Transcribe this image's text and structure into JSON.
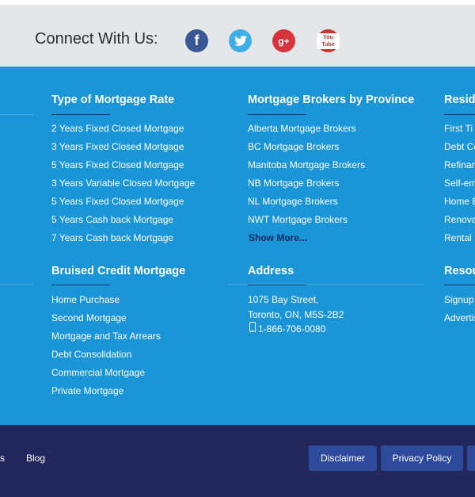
{
  "connect": {
    "title": "Connect With Us:",
    "icons": {
      "facebook": "f",
      "twitter": "🐦",
      "googleplus": "g+",
      "youtube": "You Tube"
    }
  },
  "columns": {
    "rate": {
      "heading": "Type of Mortgage Rate",
      "links": [
        "2 Years Fixed Closed Mortgage",
        "3 Years Fixed Closed Mortgage",
        "5 Years Fixed Closed Mortgage",
        "3 Years Variable Closed Mortgage",
        "5 Years Fixed Closed Mortgage",
        "5 Years Cash back Mortgage",
        "7 Years Cash back Mortgage"
      ]
    },
    "brokers": {
      "heading": "Mortgage Brokers by Province",
      "links": [
        "Alberta Mortgage Brokers",
        "BC Mortgage Brokers",
        "Manitoba Mortgage Brokers",
        "NB Mortgage Brokers",
        "NL Mortgage Brokers",
        "NWT Mortgage Brokers"
      ],
      "show_more": "Show More..."
    },
    "resid": {
      "heading": "Resid",
      "links": [
        "First Ti",
        "Debt Co",
        "Refinar",
        "Self-em",
        "Home E",
        "Renova",
        "Rental"
      ]
    },
    "bruised": {
      "heading": "Bruised Credit Mortgage",
      "links": [
        "Home Purchase",
        "Second Mortgage",
        "Mortgage and Tax Arrears",
        "Debt Consolidation",
        "Commercial Mortgage",
        "Private Mortgage"
      ]
    },
    "address": {
      "heading": "Address",
      "line1": "1075 Bay Street,",
      "line2": "Toronto, ON, M5S-2B2",
      "phone": "1-866-706-0080"
    },
    "resources": {
      "heading": "Resou",
      "links": [
        "Signup",
        "Advertis"
      ]
    }
  },
  "bottom": {
    "partial_link": "s",
    "blog": "Blog",
    "disclaimer": "Disclaimer",
    "privacy": "Privacy Policy"
  }
}
